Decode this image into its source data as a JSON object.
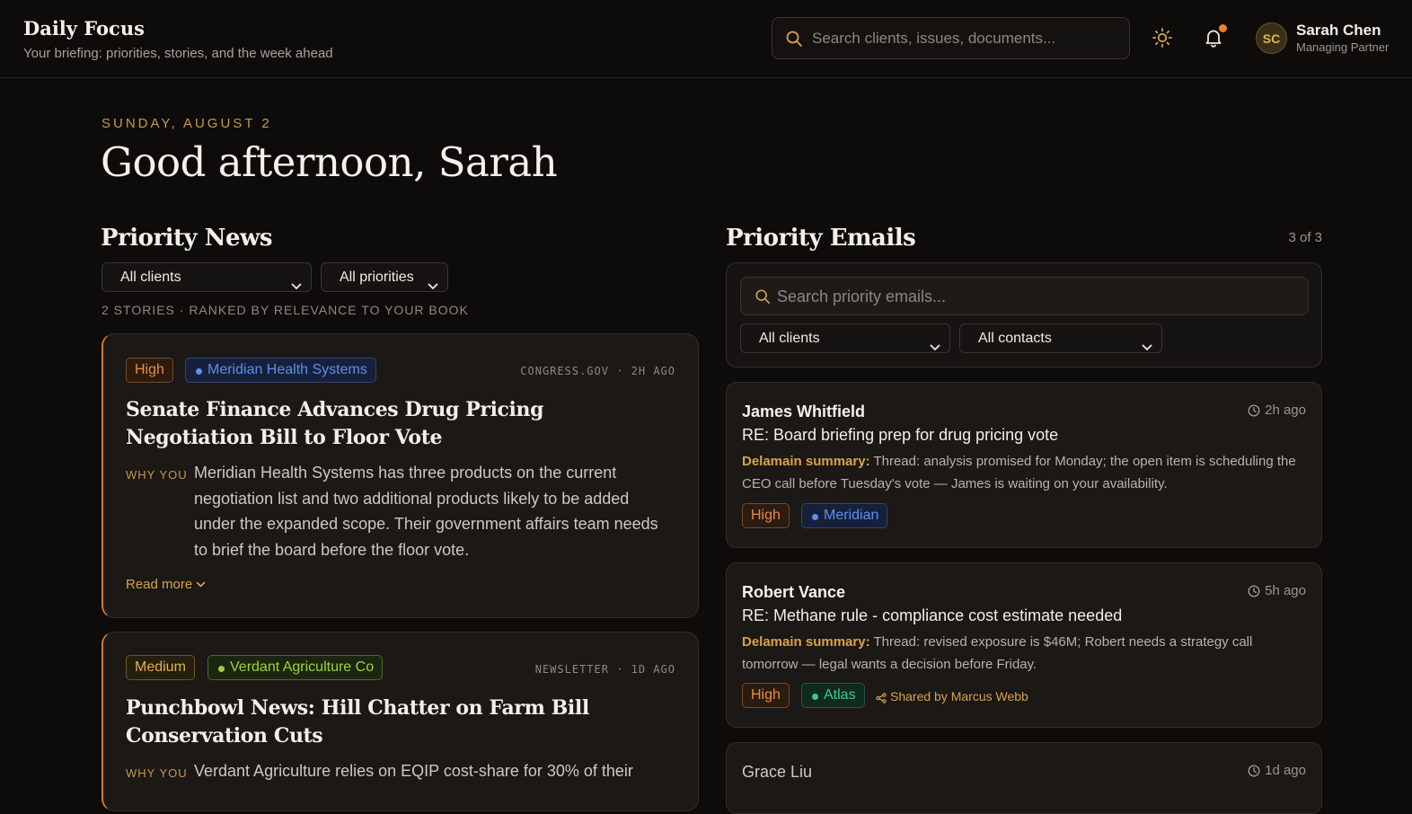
{
  "brand": {
    "title": "Daily Focus",
    "subtitle": "Your briefing: priorities, stories, and the week ahead"
  },
  "search": {
    "placeholder": "Search clients, issues, documents..."
  },
  "user": {
    "initials": "SC",
    "name": "Sarah Chen",
    "role": "Managing Partner"
  },
  "date_label": "SUNDAY, AUGUST 2",
  "greeting": "Good afternoon, Sarah",
  "news": {
    "title": "Priority News",
    "client_filter": "All clients",
    "priority_filter": "All priorities",
    "meta": "2 STORIES · RANKED BY RELEVANCE TO YOUR BOOK",
    "stories": [
      {
        "priority": "High",
        "client": "Meridian Health Systems",
        "source": "CONGRESS.GOV · 2H AGO",
        "title": "Senate Finance Advances Drug Pricing Negotiation Bill to Floor Vote",
        "why_label": "WHY YOU",
        "why_text": "Meridian Health Systems has three products on the current negotiation list and two additional products likely to be added under the expanded scope. Their government affairs team needs to brief the board before the floor vote.",
        "read_more": "Read more"
      },
      {
        "priority": "Medium",
        "client": "Verdant Agriculture Co",
        "source": "NEWSLETTER · 1D AGO",
        "title": "Punchbowl News: Hill Chatter on Farm Bill Conservation Cuts",
        "why_label": "WHY YOU",
        "why_text": "Verdant Agriculture relies on EQIP cost-share for 30% of their"
      }
    ]
  },
  "emails": {
    "title": "Priority Emails",
    "count": "3 of 3",
    "search_placeholder": "Search priority emails...",
    "client_filter": "All clients",
    "contact_filter": "All contacts",
    "summary_label": "Delamain summary:",
    "items": [
      {
        "from": "James Whitfield",
        "time": "2h ago",
        "subject": "RE: Board briefing prep for drug pricing vote",
        "summary": "Thread: analysis promised for Monday; the open item is scheduling the CEO call before Tuesday's vote — James is waiting on your availability.",
        "priority": "High",
        "client": "Meridian"
      },
      {
        "from": "Robert Vance",
        "time": "5h ago",
        "subject": "RE: Methane rule - compliance cost estimate needed",
        "summary": "Thread: revised exposure is $46M; Robert needs a strategy call tomorrow — legal wants a decision before Friday.",
        "priority": "High",
        "client": "Atlas",
        "shared": "Shared by Marcus Webb"
      },
      {
        "from": "Grace Liu",
        "time": "1d ago"
      }
    ]
  },
  "colors": {
    "accent": "#d9a24b",
    "high": "#f08a3a",
    "medium": "#e2b24a",
    "blue_client": "#5b8ff0",
    "green_client": "#9fd23c",
    "teal_client": "#3ec98c"
  }
}
